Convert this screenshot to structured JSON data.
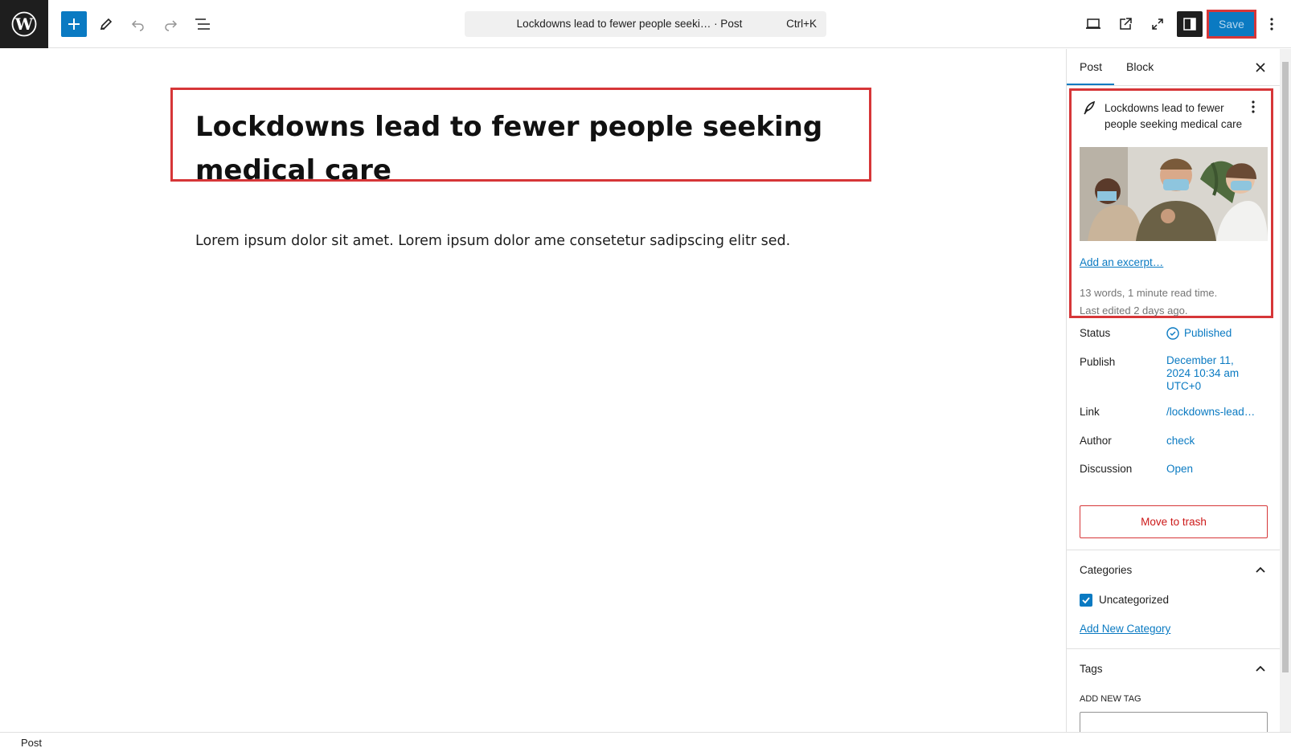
{
  "topbar": {
    "logo_icon": "wordpress-logo-icon",
    "document_title": "Lockdowns lead to fewer people seeki… · Post",
    "shortcut": "Ctrl+K",
    "save_label": "Save"
  },
  "editor": {
    "title": "Lockdowns lead to fewer people seeking medical care",
    "paragraph": "Lorem ipsum dolor sit amet. Lorem ipsum dolor ame consetetur sadipscing elitr sed."
  },
  "sidebar": {
    "tabs": [
      "Post",
      "Block"
    ],
    "summary": {
      "title": "Lockdowns lead to fewer people seeking medical care",
      "excerpt_link": "Add an excerpt…",
      "stats": "13 words, 1 minute read time.",
      "last_edited": "Last edited 2 days ago."
    },
    "rows": {
      "status_label": "Status",
      "status_value": "Published",
      "publish_label": "Publish",
      "publish_value": "December 11, 2024 10:34 am UTC+0",
      "link_label": "Link",
      "link_value": "/lockdowns-lead…",
      "author_label": "Author",
      "author_value": "check",
      "discussion_label": "Discussion",
      "discussion_value": "Open"
    },
    "trash_label": "Move to trash",
    "categories": {
      "title": "Categories",
      "items": [
        "Uncategorized"
      ],
      "add_link": "Add New Category"
    },
    "tags": {
      "title": "Tags",
      "input_label": "ADD NEW TAG"
    }
  },
  "footer": {
    "breadcrumb": "Post"
  },
  "colors": {
    "accent": "#0a7ac2",
    "highlight": "#d63638",
    "danger": "#cc1818"
  }
}
